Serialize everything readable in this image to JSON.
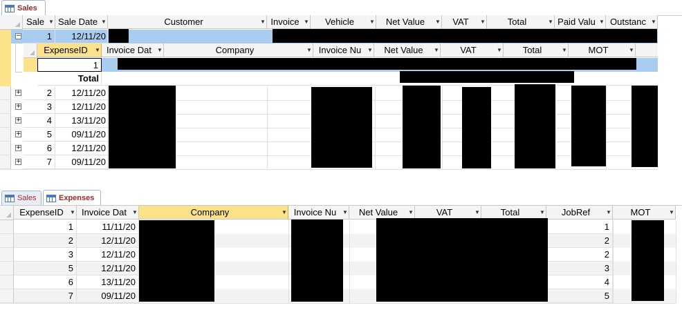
{
  "top_tabs": [
    {
      "label": "Sales"
    }
  ],
  "sales": {
    "columns": [
      "Sale",
      "Sale Date",
      "Customer",
      "Invoice",
      "Vehicle",
      "Net Value",
      "VAT",
      "Total",
      "Paid Valu",
      "Outstanc"
    ],
    "rows": [
      {
        "sale": "1",
        "date": "12/11/20"
      },
      {
        "sale": "2",
        "date": "12/11/20"
      },
      {
        "sale": "3",
        "date": "12/11/20"
      },
      {
        "sale": "4",
        "date": "13/11/20"
      },
      {
        "sale": "5",
        "date": "09/11/20"
      },
      {
        "sale": "6",
        "date": "12/11/20"
      },
      {
        "sale": "7",
        "date": "09/11/20"
      }
    ],
    "expand_open": "−",
    "expand_closed": "+"
  },
  "subdatasheet": {
    "columns": [
      "ExpenseID",
      "Invoice Dat",
      "Company",
      "Invoice Nu",
      "Net Value",
      "VAT",
      "Total",
      "MOT"
    ],
    "new_row_value": "1",
    "total_label": "Total"
  },
  "bottom_tabs": [
    {
      "label": "Sales"
    },
    {
      "label": "Expenses"
    }
  ],
  "expenses": {
    "columns": [
      "ExpenseID",
      "Invoice Dat",
      "Company",
      "Invoice Nu",
      "Net Value",
      "VAT",
      "Total",
      "JobRef",
      "MOT"
    ],
    "rows": [
      {
        "id": "1",
        "date": "11/11/20",
        "jobref": "1"
      },
      {
        "id": "2",
        "date": "12/11/20",
        "jobref": "2"
      },
      {
        "id": "3",
        "date": "12/11/20",
        "jobref": "2"
      },
      {
        "id": "5",
        "date": "12/11/20",
        "jobref": "3"
      },
      {
        "id": "6",
        "date": "13/11/20",
        "jobref": "4"
      },
      {
        "id": "7",
        "date": "09/11/20",
        "jobref": "5"
      }
    ]
  },
  "colors": {
    "tab_text": "#9c2a2a",
    "selected_row": "#a9cdf0",
    "selected_header": "#fce28b"
  }
}
